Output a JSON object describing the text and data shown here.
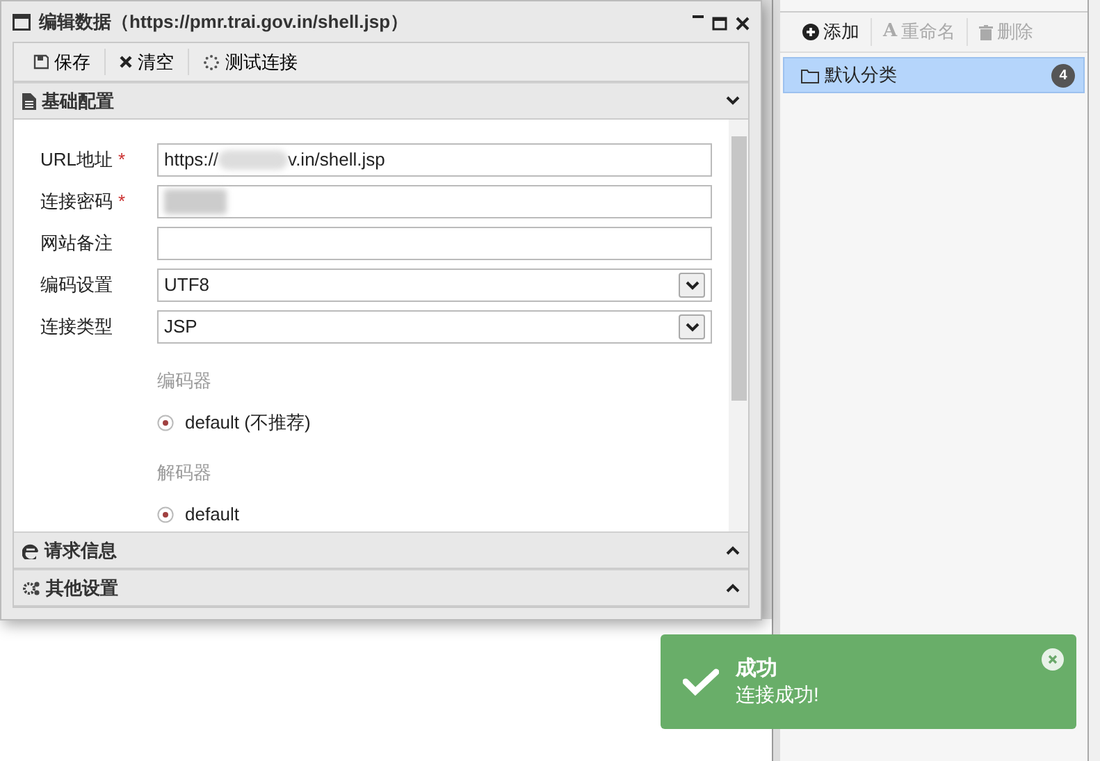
{
  "window": {
    "title": "编辑数据（https://pmr.trai.gov.in/shell.jsp）"
  },
  "toolbar": [
    {
      "label": "保存",
      "kind": "save"
    },
    {
      "label": "清空",
      "kind": "clear"
    },
    {
      "label": "测试连接",
      "kind": "test"
    }
  ],
  "sections": [
    {
      "title": "基础配置",
      "expanded": true,
      "kind": "file"
    },
    {
      "title": "请求信息",
      "expanded": false,
      "kind": "edge"
    },
    {
      "title": "其他设置",
      "expanded": false,
      "kind": "gears"
    }
  ],
  "form": {
    "fields": [
      {
        "label": "URL地址",
        "required_mark": "*",
        "kind": "text",
        "value_start": "https://",
        "value_end": "v.in/shell.jsp",
        "redacted": true
      },
      {
        "label": "连接密码",
        "required_mark": "*",
        "kind": "text",
        "redacted": true
      },
      {
        "label": "网站备注",
        "kind": "text"
      },
      {
        "label": "编码设置",
        "kind": "select",
        "value": "UTF8"
      },
      {
        "label": "连接类型",
        "kind": "select",
        "value": "JSP"
      }
    ],
    "groups": [
      {
        "title": "编码器",
        "options": [
          {
            "label": "default (不推荐)",
            "selected": true
          }
        ]
      },
      {
        "title": "解码器",
        "options": [
          {
            "label": "default",
            "selected": true
          }
        ]
      }
    ]
  },
  "category_panel": {
    "toolbar": [
      {
        "label": "添加",
        "disabled": false,
        "kind": "add"
      },
      {
        "label": "重命名",
        "disabled": true,
        "kind": "rename",
        "icon": "A"
      },
      {
        "label": "删除",
        "disabled": true,
        "kind": "delete"
      }
    ],
    "items": [
      {
        "label": "默认分类",
        "count": "4",
        "selected": true
      }
    ]
  },
  "toast": {
    "title": "成功",
    "message": "连接成功!"
  }
}
